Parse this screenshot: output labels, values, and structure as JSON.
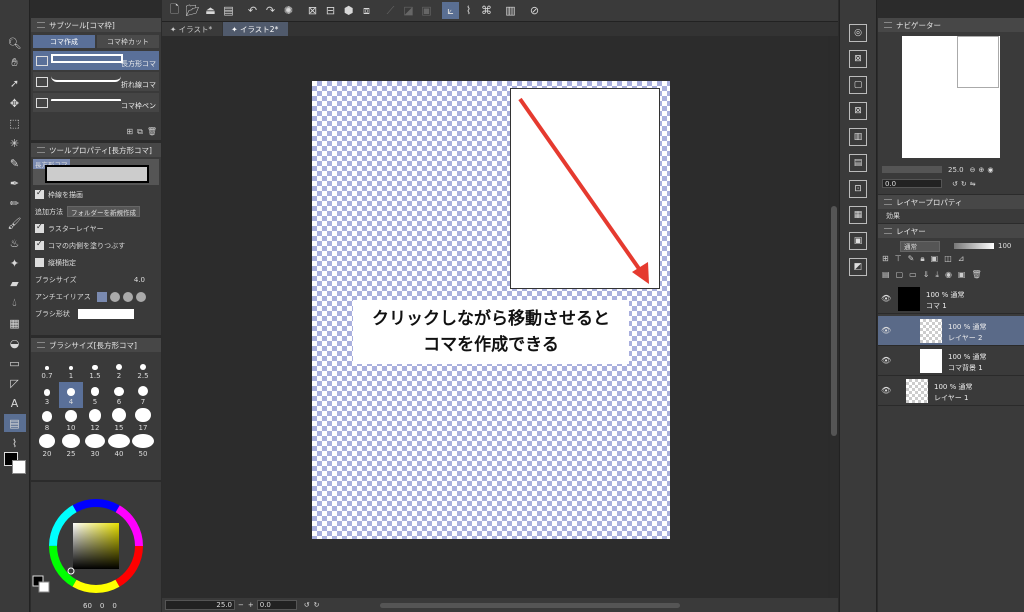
{
  "topbar": {
    "doc_tabs": [
      "イラスト*",
      "イラスト2*"
    ]
  },
  "subtool": {
    "title": "サブツール[コマ枠]",
    "tabs": [
      "コマ作成",
      "コマ枠カット"
    ],
    "items": [
      "長方形コマ",
      "折れ線コマ",
      "コマ枠ペン"
    ]
  },
  "toolprop": {
    "title": "ツールプロパティ[長方形コマ]",
    "preview_label": "長方形コマ",
    "draw_border": "枠線を描画",
    "add_method_label": "追加方法",
    "add_method_value": "フォルダーを新規作成",
    "raster_layer": "ラスターレイヤー",
    "fill_inside": "コマの内側を塗りつぶす",
    "aspect_label": "縦横指定",
    "brush_size_label": "ブラシサイズ",
    "brush_size_value": "4.0",
    "antialias_label": "アンチエイリアス",
    "brush_shape_label": "ブラシ形状"
  },
  "brushsize": {
    "title": "ブラシサイズ[長方形コマ]",
    "sizes": [
      "0.7",
      "1",
      "1.5",
      "2",
      "2.5",
      "3",
      "4",
      "5",
      "6",
      "7",
      "8",
      "10",
      "12",
      "15",
      "17",
      "20",
      "25",
      "30",
      "40",
      "50"
    ],
    "selected": "4"
  },
  "colorpanel": {
    "readouts": [
      "60",
      "0",
      "0"
    ]
  },
  "canvas": {
    "caption_line1": "クリックしながら移動させると",
    "caption_line2": "コマを作成できる",
    "arrow_color": "#e53a2f"
  },
  "statusbar": {
    "zoom": "25.0",
    "angle": "0.0"
  },
  "navigator": {
    "title": "ナビゲーター",
    "zoom": "25.0",
    "angle": "0.0"
  },
  "layerprop": {
    "title": "レイヤープロパティ",
    "effect_label": "効果"
  },
  "layers": {
    "title": "レイヤー",
    "blend_mode": "通常",
    "opacity": "100",
    "rows": [
      {
        "line1": "100 % 通常",
        "line2": "コマ 1"
      },
      {
        "line1": "100 % 通常",
        "line2": "レイヤー 2"
      },
      {
        "line1": "100 % 通常",
        "line2": "コマ背景 1"
      },
      {
        "line1": "100 % 通常",
        "line2": "レイヤー 1"
      }
    ]
  }
}
